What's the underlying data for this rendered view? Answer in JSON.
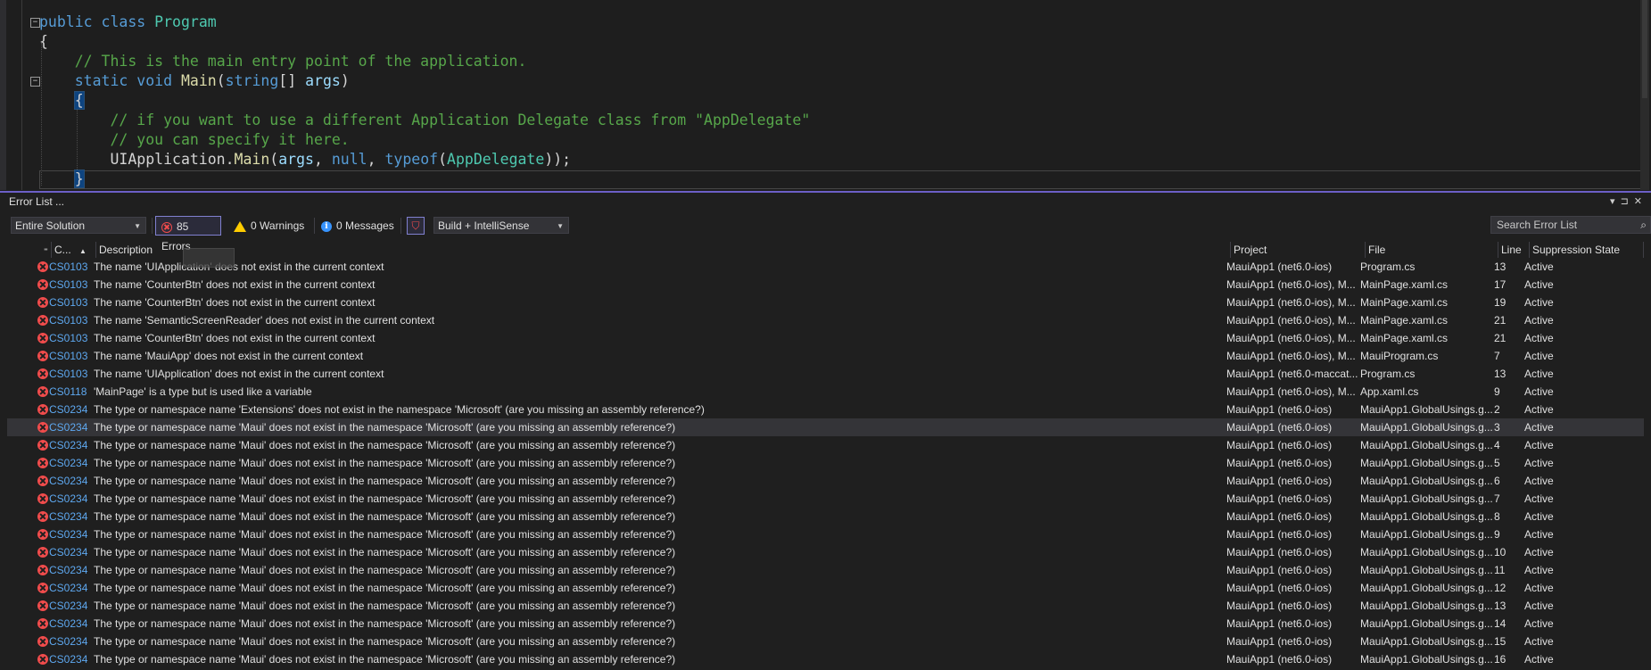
{
  "editor": {
    "lines": [
      {
        "parts": [
          [
            "kw",
            "public"
          ],
          [
            "tx",
            " "
          ],
          [
            "kw",
            "class"
          ],
          [
            "tx",
            " "
          ],
          [
            "ty",
            "Program"
          ]
        ]
      },
      {
        "parts": [
          [
            "tx",
            "{"
          ]
        ]
      },
      {
        "parts": [
          [
            "tx",
            "    "
          ],
          [
            "cm",
            "// This is the main entry point of the application."
          ]
        ]
      },
      {
        "parts": [
          [
            "tx",
            "    "
          ],
          [
            "kw",
            "static"
          ],
          [
            "tx",
            " "
          ],
          [
            "kw",
            "void"
          ],
          [
            "tx",
            " "
          ],
          [
            "mt",
            "Main"
          ],
          [
            "tx",
            "("
          ],
          [
            "kw",
            "string"
          ],
          [
            "tx",
            "[] "
          ],
          [
            "pr",
            "args"
          ],
          [
            "tx",
            ")"
          ]
        ]
      },
      {
        "parts": [
          [
            "tx",
            "    "
          ],
          [
            "hl",
            "{"
          ]
        ]
      },
      {
        "parts": [
          [
            "tx",
            "        "
          ],
          [
            "cm",
            "// if you want to use a different Application Delegate class from \"AppDelegate\""
          ]
        ]
      },
      {
        "parts": [
          [
            "tx",
            "        "
          ],
          [
            "cm",
            "// you can specify it here."
          ]
        ]
      },
      {
        "parts": [
          [
            "tx",
            "        UIApplication."
          ],
          [
            "mt",
            "Main"
          ],
          [
            "tx",
            "("
          ],
          [
            "pr",
            "args"
          ],
          [
            "tx",
            ", "
          ],
          [
            "kw",
            "null"
          ],
          [
            "tx",
            ", "
          ],
          [
            "kw",
            "typeof"
          ],
          [
            "tx",
            "("
          ],
          [
            "ty",
            "AppDelegate"
          ],
          [
            "tx",
            "));"
          ]
        ]
      },
      {
        "parts": [
          [
            "tx",
            "    "
          ],
          [
            "hl",
            "}"
          ]
        ]
      }
    ]
  },
  "panel": {
    "title": "Error List ...",
    "scope": "Entire Solution",
    "errors_label": "85 Errors",
    "warnings_label": "0 Warnings",
    "messages_label": "0 Messages",
    "build_filter": "Build + IntelliSense",
    "search_placeholder": "Search Error List",
    "columns": {
      "code": "C...",
      "description": "Description",
      "project": "Project",
      "file": "File",
      "line": "Line",
      "suppression": "Suppression State"
    },
    "rows": [
      {
        "code": "CS0103",
        "desc": "The name 'UIApplication' does not exist in the current context",
        "project": "MauiApp1 (net6.0-ios)",
        "file": "Program.cs",
        "line": "13",
        "state": "Active"
      },
      {
        "code": "CS0103",
        "desc": "The name 'CounterBtn' does not exist in the current context",
        "project": "MauiApp1 (net6.0-ios), M...",
        "file": "MainPage.xaml.cs",
        "line": "17",
        "state": "Active"
      },
      {
        "code": "CS0103",
        "desc": "The name 'CounterBtn' does not exist in the current context",
        "project": "MauiApp1 (net6.0-ios), M...",
        "file": "MainPage.xaml.cs",
        "line": "19",
        "state": "Active"
      },
      {
        "code": "CS0103",
        "desc": "The name 'SemanticScreenReader' does not exist in the current context",
        "project": "MauiApp1 (net6.0-ios), M...",
        "file": "MainPage.xaml.cs",
        "line": "21",
        "state": "Active"
      },
      {
        "code": "CS0103",
        "desc": "The name 'CounterBtn' does not exist in the current context",
        "project": "MauiApp1 (net6.0-ios), M...",
        "file": "MainPage.xaml.cs",
        "line": "21",
        "state": "Active"
      },
      {
        "code": "CS0103",
        "desc": "The name 'MauiApp' does not exist in the current context",
        "project": "MauiApp1 (net6.0-ios), M...",
        "file": "MauiProgram.cs",
        "line": "7",
        "state": "Active"
      },
      {
        "code": "CS0103",
        "desc": "The name 'UIApplication' does not exist in the current context",
        "project": "MauiApp1 (net6.0-maccat...",
        "file": "Program.cs",
        "line": "13",
        "state": "Active"
      },
      {
        "code": "CS0118",
        "desc": "'MainPage' is a type but is used like a variable",
        "project": "MauiApp1 (net6.0-ios), M...",
        "file": "App.xaml.cs",
        "line": "9",
        "state": "Active"
      },
      {
        "code": "CS0234",
        "desc": "The type or namespace name 'Extensions' does not exist in the namespace 'Microsoft' (are you missing an assembly reference?)",
        "project": "MauiApp1 (net6.0-ios)",
        "file": "MauiApp1.GlobalUsings.g...",
        "line": "2",
        "state": "Active"
      },
      {
        "code": "CS0234",
        "desc": "The type or namespace name 'Maui' does not exist in the namespace 'Microsoft' (are you missing an assembly reference?)",
        "project": "MauiApp1 (net6.0-ios)",
        "file": "MauiApp1.GlobalUsings.g...",
        "line": "3",
        "state": "Active"
      },
      {
        "code": "CS0234",
        "desc": "The type or namespace name 'Maui' does not exist in the namespace 'Microsoft' (are you missing an assembly reference?)",
        "project": "MauiApp1 (net6.0-ios)",
        "file": "MauiApp1.GlobalUsings.g...",
        "line": "4",
        "state": "Active"
      },
      {
        "code": "CS0234",
        "desc": "The type or namespace name 'Maui' does not exist in the namespace 'Microsoft' (are you missing an assembly reference?)",
        "project": "MauiApp1 (net6.0-ios)",
        "file": "MauiApp1.GlobalUsings.g...",
        "line": "5",
        "state": "Active"
      },
      {
        "code": "CS0234",
        "desc": "The type or namespace name 'Maui' does not exist in the namespace 'Microsoft' (are you missing an assembly reference?)",
        "project": "MauiApp1 (net6.0-ios)",
        "file": "MauiApp1.GlobalUsings.g...",
        "line": "6",
        "state": "Active"
      },
      {
        "code": "CS0234",
        "desc": "The type or namespace name 'Maui' does not exist in the namespace 'Microsoft' (are you missing an assembly reference?)",
        "project": "MauiApp1 (net6.0-ios)",
        "file": "MauiApp1.GlobalUsings.g...",
        "line": "7",
        "state": "Active"
      },
      {
        "code": "CS0234",
        "desc": "The type or namespace name 'Maui' does not exist in the namespace 'Microsoft' (are you missing an assembly reference?)",
        "project": "MauiApp1 (net6.0-ios)",
        "file": "MauiApp1.GlobalUsings.g...",
        "line": "8",
        "state": "Active"
      },
      {
        "code": "CS0234",
        "desc": "The type or namespace name 'Maui' does not exist in the namespace 'Microsoft' (are you missing an assembly reference?)",
        "project": "MauiApp1 (net6.0-ios)",
        "file": "MauiApp1.GlobalUsings.g...",
        "line": "9",
        "state": "Active"
      },
      {
        "code": "CS0234",
        "desc": "The type or namespace name 'Maui' does not exist in the namespace 'Microsoft' (are you missing an assembly reference?)",
        "project": "MauiApp1 (net6.0-ios)",
        "file": "MauiApp1.GlobalUsings.g...",
        "line": "10",
        "state": "Active"
      },
      {
        "code": "CS0234",
        "desc": "The type or namespace name 'Maui' does not exist in the namespace 'Microsoft' (are you missing an assembly reference?)",
        "project": "MauiApp1 (net6.0-ios)",
        "file": "MauiApp1.GlobalUsings.g...",
        "line": "11",
        "state": "Active"
      },
      {
        "code": "CS0234",
        "desc": "The type or namespace name 'Maui' does not exist in the namespace 'Microsoft' (are you missing an assembly reference?)",
        "project": "MauiApp1 (net6.0-ios)",
        "file": "MauiApp1.GlobalUsings.g...",
        "line": "12",
        "state": "Active"
      },
      {
        "code": "CS0234",
        "desc": "The type or namespace name 'Maui' does not exist in the namespace 'Microsoft' (are you missing an assembly reference?)",
        "project": "MauiApp1 (net6.0-ios)",
        "file": "MauiApp1.GlobalUsings.g...",
        "line": "13",
        "state": "Active"
      },
      {
        "code": "CS0234",
        "desc": "The type or namespace name 'Maui' does not exist in the namespace 'Microsoft' (are you missing an assembly reference?)",
        "project": "MauiApp1 (net6.0-ios)",
        "file": "MauiApp1.GlobalUsings.g...",
        "line": "14",
        "state": "Active"
      },
      {
        "code": "CS0234",
        "desc": "The type or namespace name 'Maui' does not exist in the namespace 'Microsoft' (are you missing an assembly reference?)",
        "project": "MauiApp1 (net6.0-ios)",
        "file": "MauiApp1.GlobalUsings.g...",
        "line": "15",
        "state": "Active"
      },
      {
        "code": "CS0234",
        "desc": "The type or namespace name 'Maui' does not exist in the namespace 'Microsoft' (are you missing an assembly reference?)",
        "project": "MauiApp1 (net6.0-ios)",
        "file": "MauiApp1.GlobalUsings.g...",
        "line": "16",
        "state": "Active"
      }
    ],
    "selected_row": 9
  },
  "colors": {
    "error": "#f14c4c",
    "warning": "#ffcc00",
    "info": "#3794ff",
    "accent": "#6c5fc7",
    "code_link": "#5ea8f0"
  },
  "icons": [
    "error-icon",
    "warning-icon",
    "info-icon",
    "filter-icon",
    "search-icon",
    "sort-asc-icon",
    "dropdown-arrow-icon"
  ]
}
